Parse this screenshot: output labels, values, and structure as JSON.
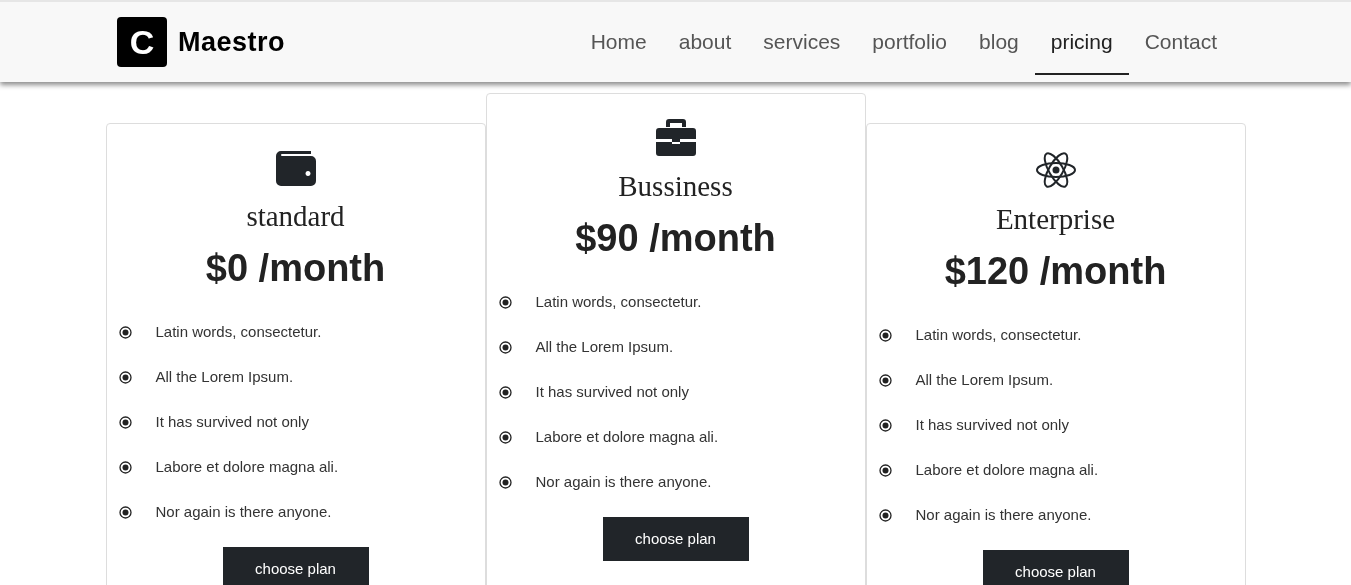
{
  "brand": {
    "letter": "C",
    "name": "Maestro"
  },
  "nav": [
    {
      "label": "Home",
      "selected": false
    },
    {
      "label": "about",
      "selected": false
    },
    {
      "label": "services",
      "selected": false
    },
    {
      "label": "portfolio",
      "selected": false
    },
    {
      "label": "blog",
      "selected": false
    },
    {
      "label": "pricing",
      "selected": true
    },
    {
      "label": "Contact",
      "selected": false
    }
  ],
  "plans": [
    {
      "name": "standard",
      "price": "$0 /month",
      "featured": false,
      "features": [
        "Latin words, consectetur.",
        "All the Lorem Ipsum.",
        "It has survived not only",
        "Labore et dolore magna ali.",
        "Nor again is there anyone."
      ],
      "button": "choose plan"
    },
    {
      "name": "Bussiness",
      "price": "$90 /month",
      "featured": true,
      "features": [
        "Latin words, consectetur.",
        "All the Lorem Ipsum.",
        "It has survived not only",
        "Labore et dolore magna ali.",
        "Nor again is there anyone."
      ],
      "button": "choose plan"
    },
    {
      "name": "Enterprise",
      "price": "$120 /month",
      "featured": false,
      "features": [
        "Latin words, consectetur.",
        "All the Lorem Ipsum.",
        "It has survived not only",
        "Labore et dolore magna ali.",
        "Nor again is there anyone."
      ],
      "button": "choose plan"
    }
  ]
}
